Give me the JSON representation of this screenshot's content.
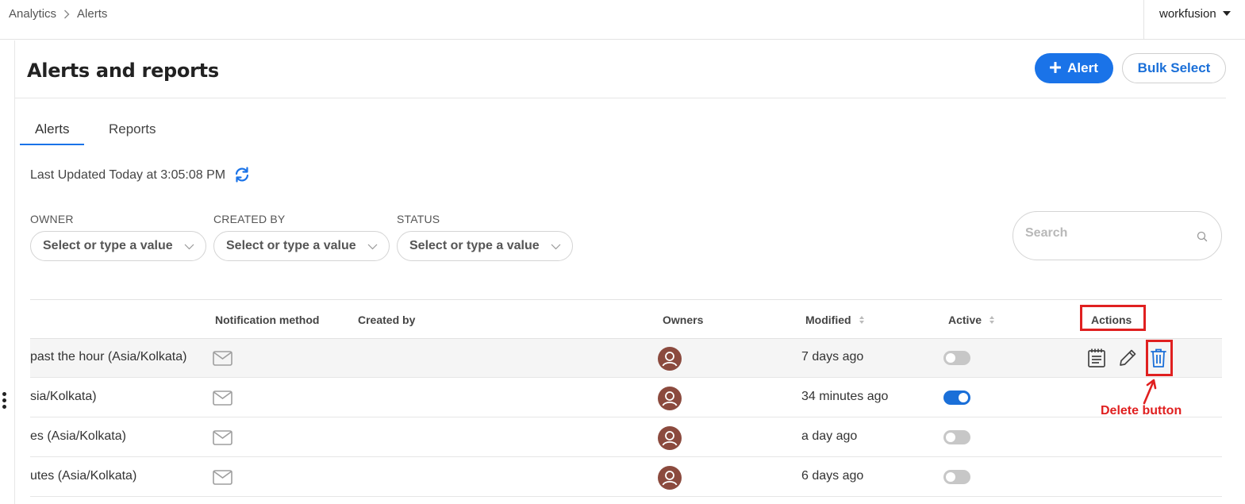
{
  "breadcrumb": {
    "root": "Analytics",
    "current": "Alerts"
  },
  "user": {
    "name": "workfusion"
  },
  "header": {
    "title": "Alerts and reports",
    "add_alert_label": "Alert",
    "bulk_select_label": "Bulk Select"
  },
  "tabs": [
    {
      "label": "Alerts",
      "active": true
    },
    {
      "label": "Reports",
      "active": false
    }
  ],
  "status": {
    "last_updated": "Last Updated Today at 3:05:08 PM"
  },
  "filters": [
    {
      "label": "OWNER",
      "placeholder": "Select or type a value"
    },
    {
      "label": "CREATED BY",
      "placeholder": "Select or type a value"
    },
    {
      "label": "STATUS",
      "placeholder": "Select or type a value"
    }
  ],
  "search": {
    "placeholder": "Search"
  },
  "table": {
    "columns": {
      "notification_method": "Notification method",
      "created_by": "Created by",
      "owners": "Owners",
      "modified": "Modified",
      "active": "Active",
      "actions": "Actions"
    },
    "rows": [
      {
        "name": " past the hour (Asia/Kolkata)",
        "notification": "email-icon",
        "modified": "7 days ago",
        "active": false
      },
      {
        "name": "sia/Kolkata)",
        "notification": "email-icon",
        "modified": "34 minutes ago",
        "active": true
      },
      {
        "name": "es (Asia/Kolkata)",
        "notification": "email-icon",
        "modified": "a day ago",
        "active": false
      },
      {
        "name": "utes (Asia/Kolkata)",
        "notification": "email-icon",
        "modified": "6 days ago",
        "active": false
      }
    ]
  },
  "annotation": {
    "label": "Delete button"
  },
  "colors": {
    "primary": "#1a73e8",
    "annotation": "#e02020",
    "avatar": "#8b4a3e"
  }
}
